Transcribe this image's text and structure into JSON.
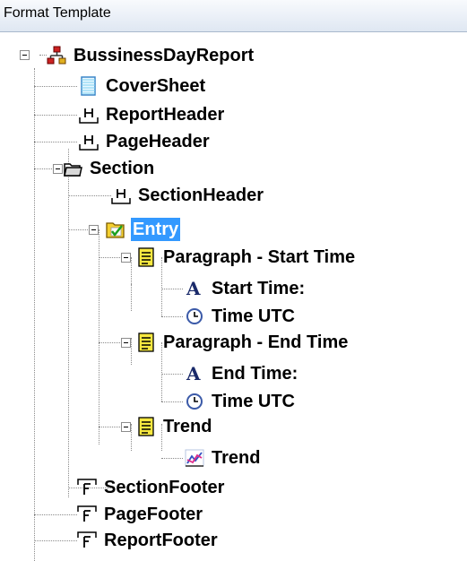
{
  "window": {
    "title": "Format Template"
  },
  "tree": {
    "root": "BussinessDayReport",
    "cover_sheet": "CoverSheet",
    "report_header": "ReportHeader",
    "page_header": "PageHeader",
    "section": "Section",
    "section_header": "SectionHeader",
    "entry": "Entry",
    "para_start": "Paragraph - Start Time",
    "start_time_text": "Start Time:",
    "start_time_utc": "Time UTC",
    "para_end": "Paragraph - End Time",
    "end_time_text": "End Time:",
    "end_time_utc": "Time UTC",
    "trend_para": "Trend",
    "trend_chart": "Trend",
    "section_footer": "SectionFooter",
    "page_footer": "PageFooter",
    "report_footer": "ReportFooter"
  },
  "colors": {
    "selection": "#3399ff",
    "header_bg": "#dfe7f2"
  }
}
